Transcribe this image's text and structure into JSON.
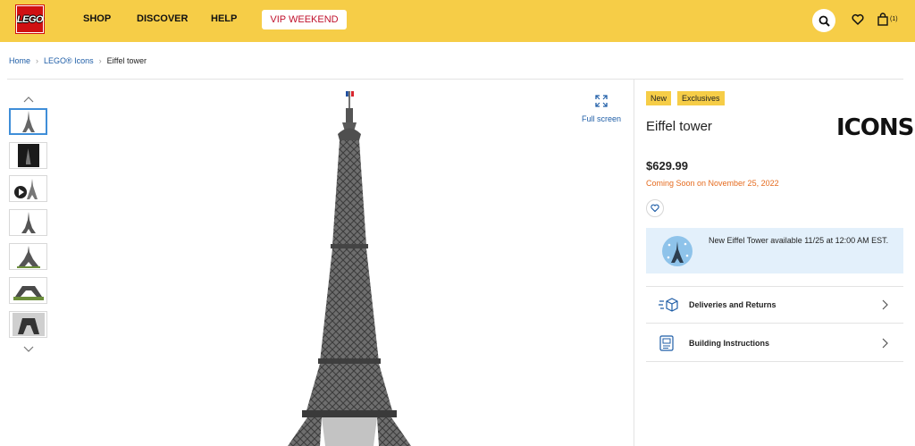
{
  "header": {
    "logo_text": "LEGO",
    "nav": [
      "SHOP",
      "DISCOVER",
      "HELP"
    ],
    "vip_label": "VIP WEEKEND",
    "bag_count": "(1)",
    "icons": [
      "search-icon",
      "heart-icon",
      "bag-icon"
    ]
  },
  "breadcrumb": {
    "home": "Home",
    "category": "LEGO® Icons",
    "current": "Eiffel tower"
  },
  "gallery": {
    "thumbnail_count": 7,
    "fullscreen_label": "Full screen"
  },
  "product": {
    "badges": [
      "New",
      "Exclusives"
    ],
    "title": "Eiffel tower",
    "brand_logo": "ICONS.",
    "price": "$629.99",
    "availability": "Coming Soon on November 25, 2022",
    "notice": "New Eiffel Tower available 11/25 at 12:00 AM EST.",
    "links": [
      "Deliveries and Returns",
      "Building Instructions"
    ]
  },
  "colors": {
    "header_bg": "#f6cd47",
    "logo_red": "#d01012",
    "link_blue": "#1f5ea7",
    "availability_orange": "#e56b1f",
    "notice_bg": "#e3f0fb"
  }
}
